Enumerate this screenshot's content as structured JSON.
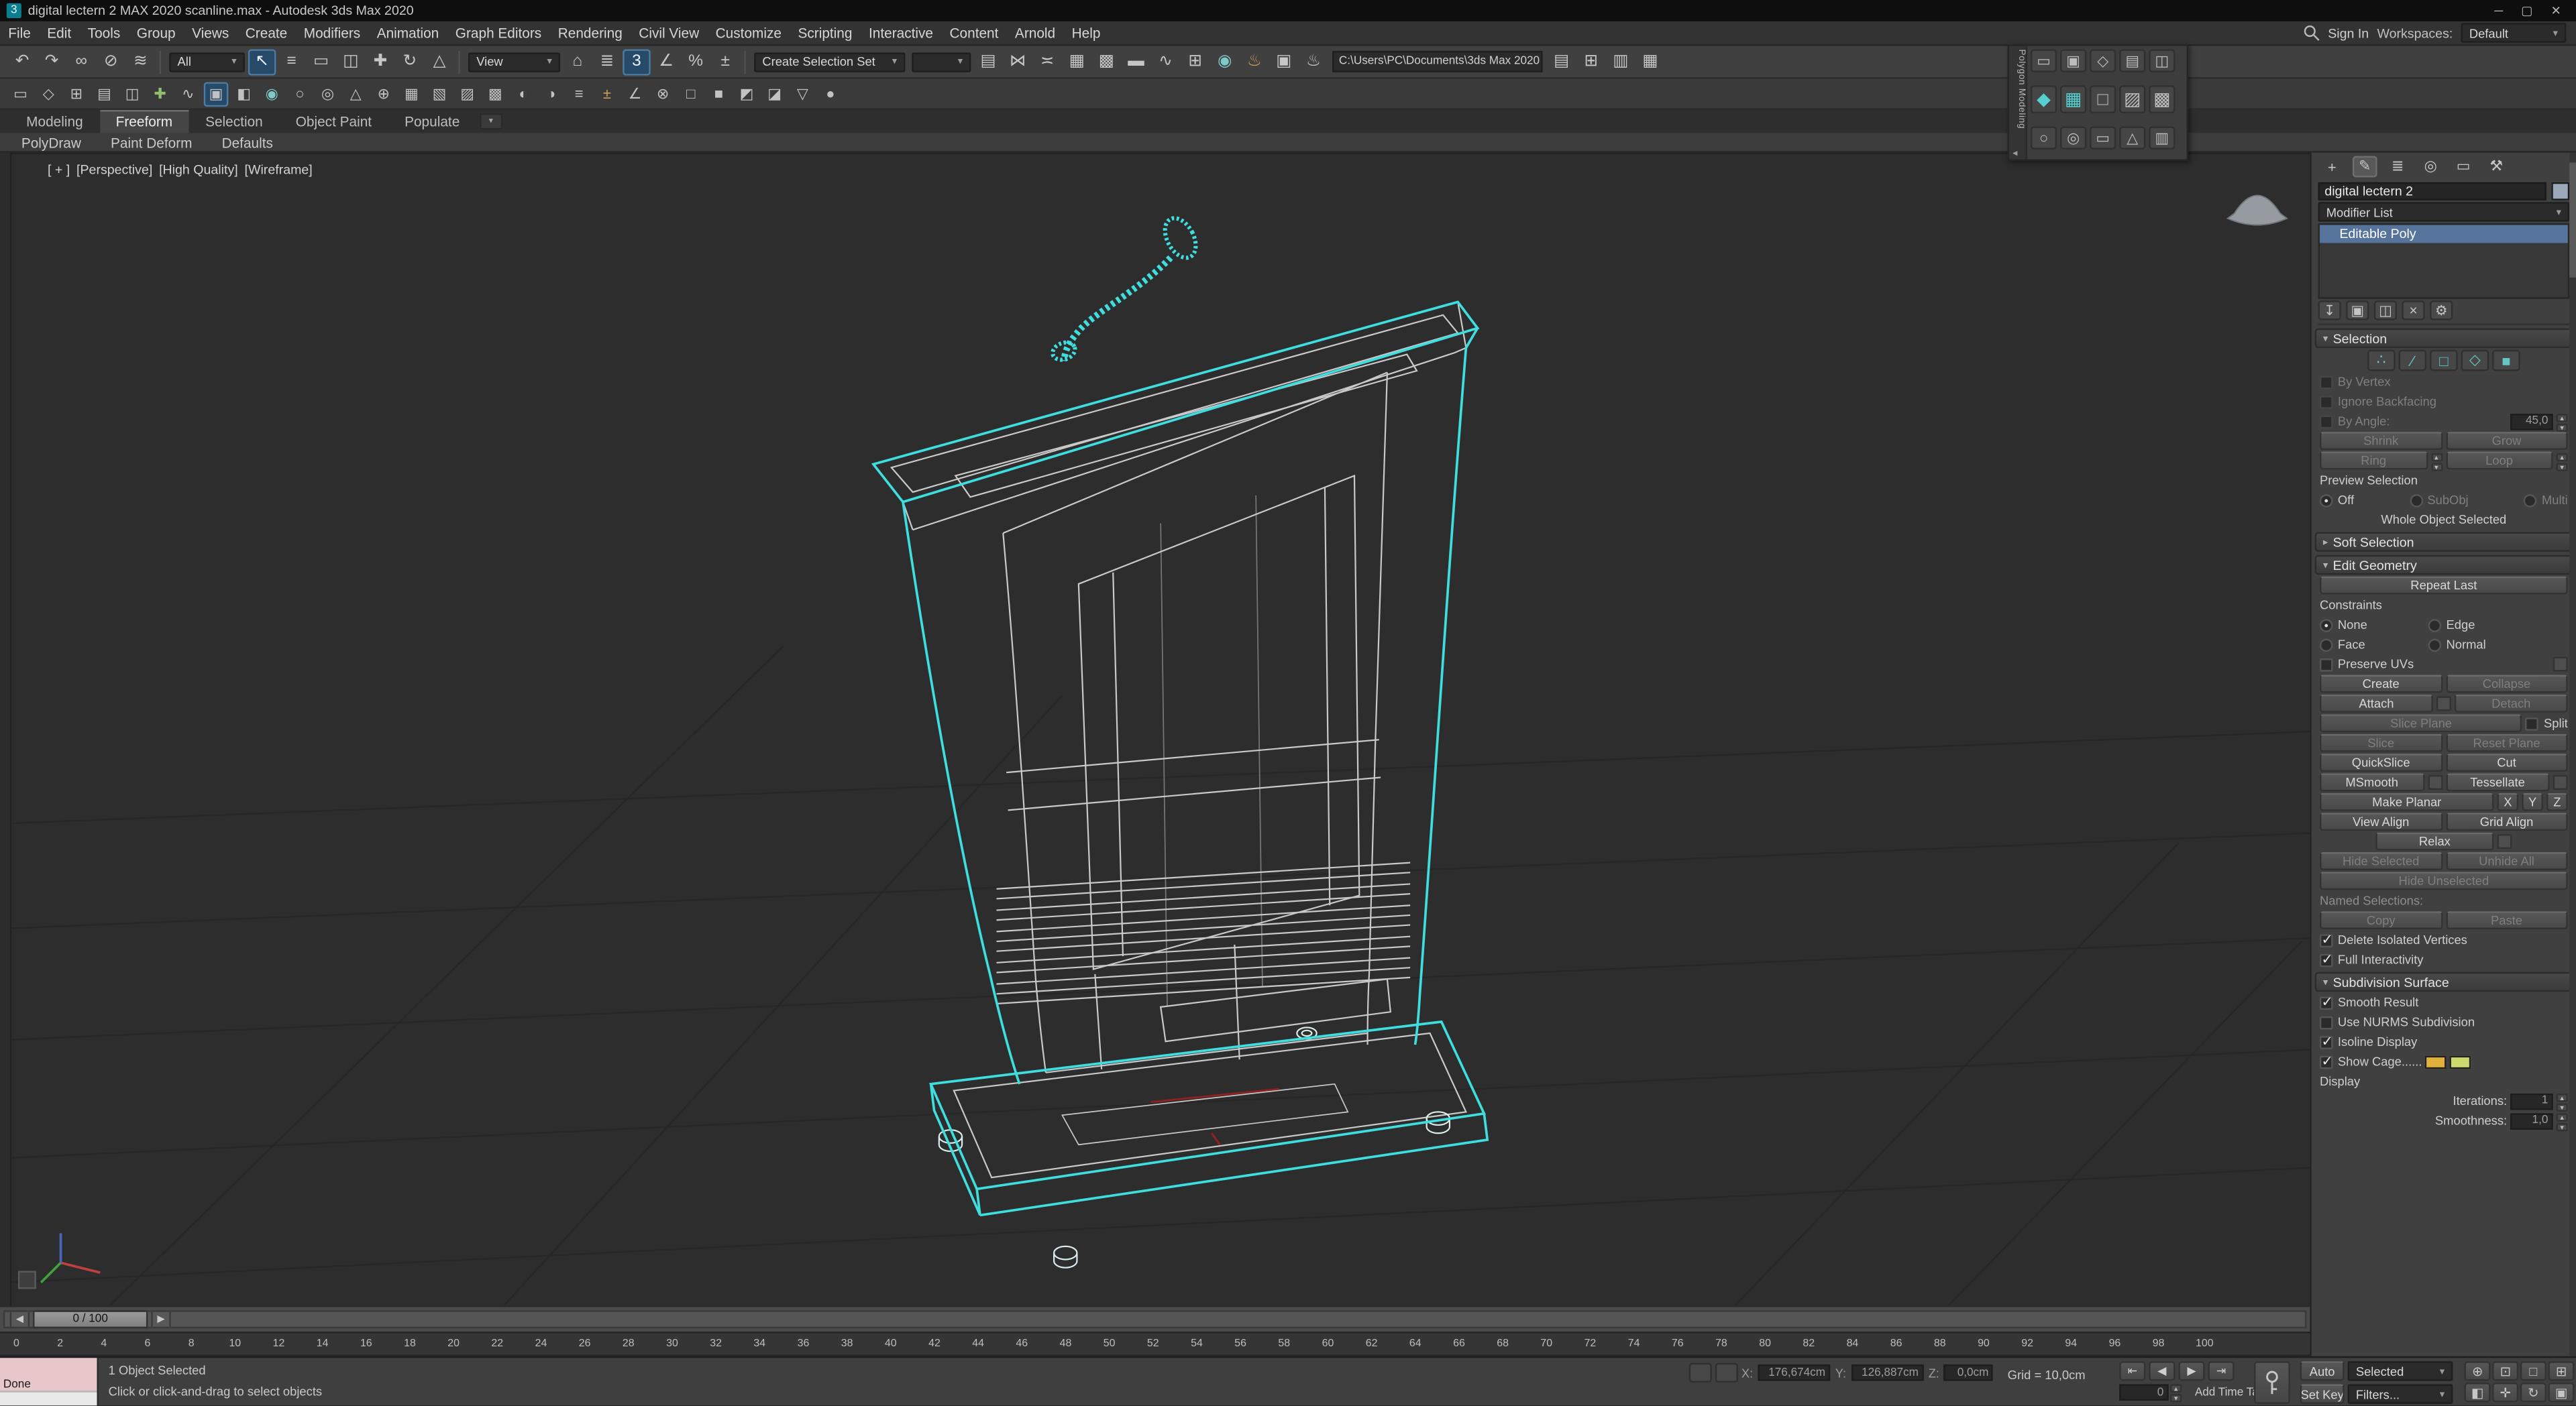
{
  "window": {
    "title": "digital lectern 2 MAX 2020 scanline.max - Autodesk 3ds Max 2020",
    "app_icon": "3",
    "controls": [
      {
        "name": "minimize-button",
        "glyph": "─"
      },
      {
        "name": "maximize-button",
        "glyph": "▢"
      },
      {
        "name": "close-button",
        "glyph": "✕"
      }
    ]
  },
  "menu": {
    "items": [
      "File",
      "Edit",
      "Tools",
      "Group",
      "Views",
      "Create",
      "Modifiers",
      "Animation",
      "Graph Editors",
      "Rendering",
      "Civil View",
      "Customize",
      "Scripting",
      "Interactive",
      "Content",
      "Arnold",
      "Help"
    ],
    "sign_in": "Sign In",
    "workspaces_label": "Workspaces:",
    "workspace_value": "Default"
  },
  "toolbar": {
    "icons_a": [
      {
        "name": "undo-icon",
        "glyph": "↶"
      },
      {
        "name": "redo-icon",
        "glyph": "↷"
      },
      {
        "name": "select-and-link-icon",
        "glyph": "∞"
      },
      {
        "name": "unlink-selection-icon",
        "glyph": "⊘"
      },
      {
        "name": "bind-to-space-warp-icon",
        "glyph": "≋"
      }
    ],
    "selection_filter_value": "All",
    "icons_b": [
      {
        "name": "select-object-icon",
        "glyph": "↖",
        "active": true
      },
      {
        "name": "select-by-name-icon",
        "glyph": "≡"
      },
      {
        "name": "rectangular-selection-region-icon",
        "glyph": "▭"
      },
      {
        "name": "window-crossing-icon",
        "glyph": "◫"
      },
      {
        "name": "select-and-move-icon",
        "glyph": "✚"
      },
      {
        "name": "select-and-rotate-icon",
        "glyph": "↻"
      },
      {
        "name": "select-and-scale-icon",
        "glyph": "△"
      }
    ],
    "view_label": "View",
    "icons_c": [
      {
        "name": "select-and-place-icon",
        "glyph": "⌂"
      },
      {
        "name": "keyboard-override-icon",
        "glyph": "≣"
      },
      {
        "name": "snaps-toggle-icon",
        "glyph": "3",
        "active": true
      },
      {
        "name": "angle-snap-icon",
        "glyph": "∠"
      },
      {
        "name": "percent-snap-icon",
        "glyph": "%"
      },
      {
        "name": "spinner-snap-icon",
        "glyph": "±"
      }
    ],
    "selection_set_label": "Create Selection Set",
    "selection_set_value": "",
    "icons_d": [
      {
        "name": "edit-named-selection-sets-icon",
        "glyph": "▤"
      },
      {
        "name": "mirror-icon",
        "glyph": "⋈"
      },
      {
        "name": "align-icon",
        "glyph": "≍"
      },
      {
        "name": "scene-explorer-icon",
        "glyph": "▦"
      },
      {
        "name": "layer-explorer-icon",
        "glyph": "▩"
      },
      {
        "name": "ribbon-toggle-icon",
        "glyph": "▬"
      },
      {
        "name": "curve-editor-icon",
        "glyph": "∿"
      },
      {
        "name": "schematic-view-icon",
        "glyph": "⊞"
      },
      {
        "name": "material-editor-icon",
        "glyph": "◉",
        "color": "#7fc9c9"
      },
      {
        "name": "render-setup-icon",
        "glyph": "♨",
        "color": "#c9a05a"
      },
      {
        "name": "rendered-frame-icon",
        "glyph": "▣"
      },
      {
        "name": "render-production-icon",
        "glyph": "♨"
      }
    ],
    "project_path": "C:\\Users\\PC\\Documents\\3ds Max 2020",
    "icons_e": [
      {
        "name": "toolbar-extra-icon",
        "glyph": "▤"
      },
      {
        "name": "toolbar-extra-icon",
        "glyph": "⊞"
      },
      {
        "name": "toolbar-extra-icon",
        "glyph": "▥"
      },
      {
        "name": "toolbar-extra-icon",
        "glyph": "▦"
      }
    ]
  },
  "ribbon": {
    "icons": [
      {
        "name": "ribbon-icon",
        "glyph": "▭"
      },
      {
        "name": "ribbon-icon",
        "glyph": "◇"
      },
      {
        "name": "ribbon-icon",
        "glyph": "⊞"
      },
      {
        "name": "ribbon-icon",
        "glyph": "▤"
      },
      {
        "name": "ribbon-icon",
        "glyph": "◫"
      },
      {
        "name": "ribbon-icon",
        "glyph": "✚",
        "color": "#8fbf6f"
      },
      {
        "name": "ribbon-icon",
        "glyph": "∿"
      },
      {
        "name": "ribbon-icon",
        "glyph": "▣",
        "active": true
      },
      {
        "name": "ribbon-icon",
        "glyph": "◧"
      },
      {
        "name": "ribbon-icon",
        "glyph": "◉",
        "color": "#7fc9c9"
      },
      {
        "name": "ribbon-icon",
        "glyph": "○"
      },
      {
        "name": "ribbon-icon",
        "glyph": "◎"
      },
      {
        "name": "ribbon-icon",
        "glyph": "△"
      },
      {
        "name": "ribbon-icon",
        "glyph": "⊕"
      },
      {
        "name": "ribbon-icon",
        "glyph": "▦"
      },
      {
        "name": "ribbon-icon",
        "glyph": "▧"
      },
      {
        "name": "ribbon-icon",
        "glyph": "▨"
      },
      {
        "name": "ribbon-icon",
        "glyph": "▩"
      },
      {
        "name": "ribbon-icon",
        "glyph": "◐"
      },
      {
        "name": "ribbon-icon",
        "glyph": "◑"
      },
      {
        "name": "ribbon-icon",
        "glyph": "≡"
      },
      {
        "name": "ribbon-icon",
        "glyph": "±",
        "color": "#c9a05a"
      },
      {
        "name": "ribbon-icon",
        "glyph": "∠"
      },
      {
        "name": "ribbon-icon",
        "glyph": "⊗"
      },
      {
        "name": "ribbon-icon",
        "glyph": "□"
      },
      {
        "name": "ribbon-icon",
        "glyph": "■"
      },
      {
        "name": "ribbon-icon",
        "glyph": "◩"
      },
      {
        "name": "ribbon-icon",
        "glyph": "◪"
      },
      {
        "name": "ribbon-icon",
        "glyph": "▽"
      },
      {
        "name": "ribbon-icon",
        "glyph": "●"
      }
    ],
    "tabs": [
      {
        "name": "tab-modeling",
        "label": "Modeling"
      },
      {
        "name": "tab-freeform",
        "label": "Freeform",
        "active": true
      },
      {
        "name": "tab-selection",
        "label": "Selection"
      },
      {
        "name": "tab-object-paint",
        "label": "Object Paint"
      },
      {
        "name": "tab-populate",
        "label": "Populate"
      }
    ],
    "subtabs": [
      "PolyDraw",
      "Paint Deform",
      "Defaults"
    ]
  },
  "viewport": {
    "label_segments": [
      "[ + ]",
      "[Perspective]",
      "[High Quality]",
      "[Wireframe]"
    ]
  },
  "floater": {
    "title": "Polygon Modeling",
    "collapse_glyph": "◂",
    "row1": [
      {
        "name": "pm-icon",
        "glyph": "▭"
      },
      {
        "name": "pm-icon",
        "glyph": "▣"
      },
      {
        "name": "pm-icon",
        "glyph": "◇"
      },
      {
        "name": "pm-icon",
        "glyph": "▤"
      },
      {
        "name": "pm-icon",
        "glyph": "◫"
      }
    ],
    "row2": [
      {
        "name": "pm-vertex-icon",
        "glyph": "◆",
        "color": "#55d0d0"
      },
      {
        "name": "pm-polygon-icon",
        "glyph": "▦",
        "color": "#55d0d0"
      },
      {
        "name": "pm-icon",
        "glyph": "□"
      },
      {
        "name": "pm-icon",
        "glyph": "▨"
      },
      {
        "name": "pm-icon",
        "glyph": "▩"
      }
    ],
    "row3": [
      {
        "name": "pm-icon",
        "glyph": "○"
      },
      {
        "name": "pm-icon",
        "glyph": "◎"
      },
      {
        "name": "pm-icon",
        "glyph": "▭"
      },
      {
        "name": "pm-icon",
        "glyph": "△"
      },
      {
        "name": "pm-icon",
        "glyph": "▥"
      }
    ]
  },
  "panel": {
    "tabs": [
      {
        "name": "create-tab-icon",
        "glyph": "+"
      },
      {
        "name": "modify-tab-icon",
        "glyph": "✎",
        "active": true
      },
      {
        "name": "hierarchy-tab-icon",
        "glyph": "≣"
      },
      {
        "name": "motion-tab-icon",
        "glyph": "◎"
      },
      {
        "name": "display-tab-icon",
        "glyph": "▭"
      },
      {
        "name": "utilities-tab-icon",
        "glyph": "⚒"
      }
    ],
    "object_name": "digital lectern 2",
    "object_color": "#9aa8ba",
    "modifier_list_label": "Modifier List",
    "stack_item": "Editable Poly",
    "stack_icons": [
      {
        "name": "pin-stack-icon",
        "glyph": "↧"
      },
      {
        "name": "show-end-result-icon",
        "glyph": "▣"
      },
      {
        "name": "make-unique-icon",
        "glyph": "◫"
      },
      {
        "name": "remove-modifier-icon",
        "glyph": "×"
      },
      {
        "name": "configure-modifier-sets-icon",
        "glyph": "⚙"
      }
    ],
    "selection": {
      "title": "Selection",
      "subobject_icons": [
        {
          "name": "vertex-mode-icon",
          "glyph": "∴"
        },
        {
          "name": "edge-mode-icon",
          "glyph": "∕"
        },
        {
          "name": "border-mode-icon",
          "glyph": "□"
        },
        {
          "name": "polygon-mode-icon",
          "glyph": "◇"
        },
        {
          "name": "element-mode-icon",
          "glyph": "■"
        }
      ],
      "by_vertex": "By Vertex",
      "ignore_backfacing": "Ignore Backfacing",
      "by_angle": "By Angle:",
      "by_angle_value": "45,0",
      "shrink": "Shrink",
      "grow": "Grow",
      "ring": "Ring",
      "loop": "Loop",
      "preview_selection": "Preview Selection",
      "off": "Off",
      "subobj": "SubObj",
      "multi": "Multi",
      "whole_object": "Whole Object Selected"
    },
    "soft_selection_title": "Soft Selection",
    "edit_geometry": {
      "title": "Edit Geometry",
      "repeat_last": "Repeat Last",
      "constraints": "Constraints",
      "none": "None",
      "edge": "Edge",
      "face": "Face",
      "normal": "Normal",
      "preserve_uvs": "Preserve UVs",
      "create": "Create",
      "collapse": "Collapse",
      "attach": "Attach",
      "detach": "Detach",
      "slice_plane": "Slice Plane",
      "split": "Split",
      "slice": "Slice",
      "reset_plane": "Reset Plane",
      "quickslice": "QuickSlice",
      "cut": "Cut",
      "msmooth": "MSmooth",
      "tessellate": "Tessellate",
      "make_planar": "Make Planar",
      "x": "X",
      "y": "Y",
      "z": "Z",
      "view_align": "View Align",
      "grid_align": "Grid Align",
      "relax": "Relax",
      "hide_selected": "Hide Selected",
      "unhide_all": "Unhide All",
      "hide_unselected": "Hide Unselected",
      "named_selections": "Named Selections:",
      "copy": "Copy",
      "paste": "Paste",
      "delete_isolated": "Delete Isolated Vertices",
      "full_interactivity": "Full Interactivity"
    },
    "subdivision": {
      "title": "Subdivision Surface",
      "smooth_result": "Smooth Result",
      "use_nurms": "Use NURMS Subdivision",
      "isoline": "Isoline Display",
      "show_cage": "Show Cage......",
      "cage_colors": [
        "#e0b23c",
        "#cdd96e"
      ],
      "display": "Display",
      "iterations": "Iterations:",
      "iterations_value": "1",
      "smoothness": "Smoothness:",
      "smoothness_value": "1,0"
    }
  },
  "timeline": {
    "slider_label": "0 / 100",
    "back_glyph": "◀",
    "forward_glyph": "▶",
    "ticks": [
      0,
      2,
      4,
      6,
      8,
      10,
      12,
      14,
      16,
      18,
      20,
      22,
      24,
      26,
      28,
      30,
      32,
      34,
      36,
      38,
      40,
      42,
      44,
      46,
      48,
      50,
      52,
      54,
      56,
      58,
      60,
      62,
      64,
      66,
      68,
      70,
      72,
      74,
      76,
      78,
      80,
      82,
      84,
      86,
      88,
      90,
      92,
      94,
      96,
      98,
      100
    ]
  },
  "status": {
    "done": "Done",
    "selected_info": "1 Object Selected",
    "prompt": "Click or click-and-drag to select objects",
    "left_icons": [
      {
        "name": "isolate-selection-icon",
        "glyph": "⊙"
      },
      {
        "name": "lock-selection-icon",
        "glyph": "⊠"
      }
    ],
    "x": "X:",
    "x_value": "176,674cm",
    "y": "Y:",
    "y_value": "126,887cm",
    "z": "Z:",
    "z_value": "0,0cm",
    "grid": "Grid = 10,0cm",
    "playback_icons": [
      {
        "name": "go-to-start-icon",
        "glyph": "⇤"
      },
      {
        "name": "previous-frame-icon",
        "glyph": "◀"
      },
      {
        "name": "play-icon",
        "glyph": "▶"
      },
      {
        "name": "go-to-end-icon",
        "glyph": "⇥"
      }
    ],
    "frame_value": "0",
    "add_time_tag": "Add Time Tag",
    "auto": "Auto",
    "selected_dropdown": "Selected",
    "set_key": "Set Key",
    "key_filters": "Filters...",
    "nav_icons": [
      {
        "name": "zoom-icon",
        "glyph": "⊕"
      },
      {
        "name": "zoom-all-icon",
        "glyph": "⊡"
      },
      {
        "name": "zoom-extents-icon",
        "glyph": "□"
      },
      {
        "name": "zoom-extents-all-icon",
        "glyph": "⊞"
      },
      {
        "name": "zoom-region-icon",
        "glyph": "◧"
      },
      {
        "name": "pan-icon",
        "glyph": "✛"
      },
      {
        "name": "orbit-icon",
        "glyph": "↻"
      },
      {
        "name": "maximize-viewport-icon",
        "glyph": "▣"
      }
    ]
  }
}
